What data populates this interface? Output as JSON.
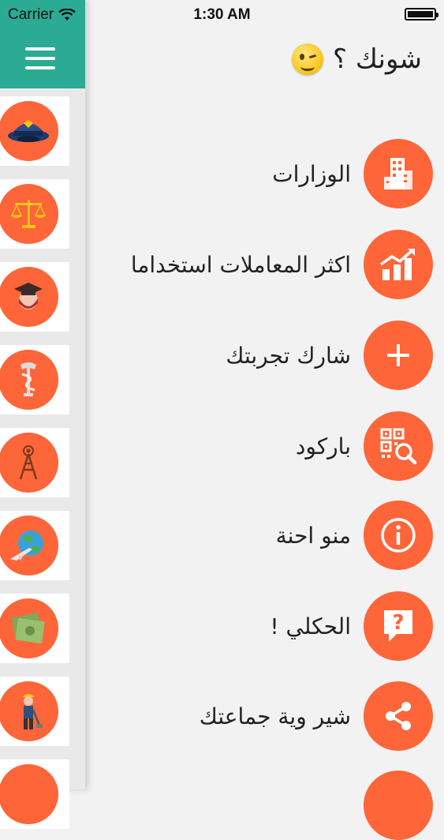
{
  "status_bar": {
    "carrier": "Carrier",
    "time": "1:30 AM"
  },
  "header": {
    "greeting": "شونك ؟",
    "emoji": "winking-face"
  },
  "menu": [
    {
      "label": "الوزارات",
      "icon": "building-icon"
    },
    {
      "label": "اكثر المعاملات استخداما",
      "icon": "chart-growth-icon"
    },
    {
      "label": "شارك تجربتك",
      "icon": "plus-icon"
    },
    {
      "label": "باركود",
      "icon": "qr-search-icon"
    },
    {
      "label": "منو احنة",
      "icon": "info-icon"
    },
    {
      "label": "الحكلي !",
      "icon": "question-icon"
    },
    {
      "label": "شير وية جماعتك",
      "icon": "share-icon"
    }
  ],
  "sidebar": {
    "categories": [
      {
        "icon": "police-cap-icon"
      },
      {
        "icon": "justice-scale-icon"
      },
      {
        "icon": "graduate-icon"
      },
      {
        "icon": "pharmacy-icon"
      },
      {
        "icon": "tower-antenna-icon"
      },
      {
        "icon": "globe-airplane-icon"
      },
      {
        "icon": "money-icon"
      },
      {
        "icon": "worker-icon"
      }
    ]
  },
  "colors": {
    "accent": "#fe6539",
    "topbar": "#2bab94",
    "background": "#f2f2f2"
  }
}
